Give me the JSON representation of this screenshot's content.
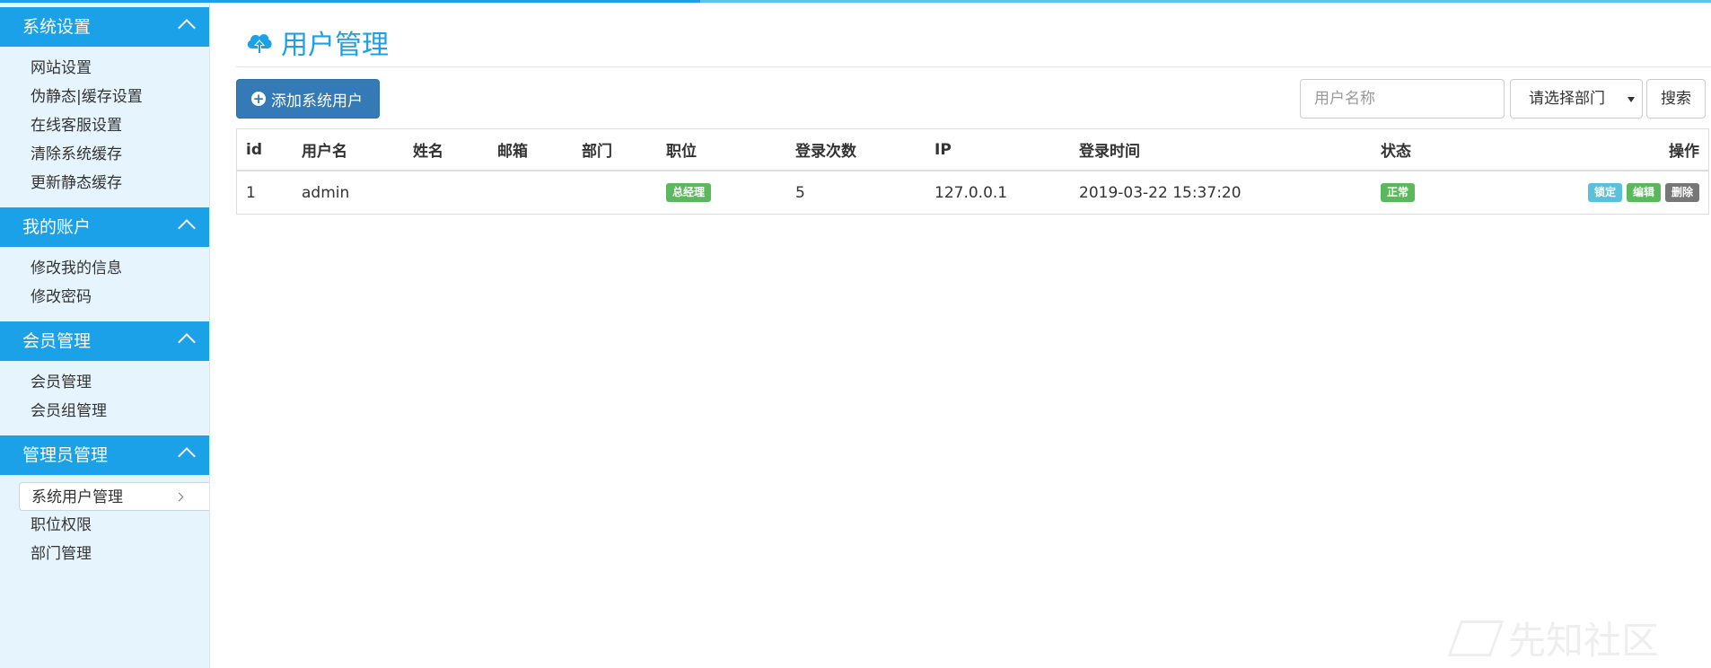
{
  "colors": {
    "primary": "#1aa1e8",
    "sidebar_bg": "#e6f4fe",
    "button_primary": "#337ab7",
    "label_green": "#5cb85c",
    "label_info": "#5bc0de",
    "label_gray": "#777777"
  },
  "sidebar": {
    "groups": [
      {
        "title": "系统设置",
        "items": [
          {
            "label": "网站设置"
          },
          {
            "label": "伪静态|缓存设置"
          },
          {
            "label": "在线客服设置"
          },
          {
            "label": "清除系统缓存"
          },
          {
            "label": "更新静态缓存"
          }
        ]
      },
      {
        "title": "我的账户",
        "items": [
          {
            "label": "修改我的信息"
          },
          {
            "label": "修改密码"
          }
        ]
      },
      {
        "title": "会员管理",
        "items": [
          {
            "label": "会员管理"
          },
          {
            "label": "会员组管理"
          }
        ]
      },
      {
        "title": "管理员管理",
        "items": [
          {
            "label": "系统用户管理",
            "active": true
          },
          {
            "label": "职位权限"
          },
          {
            "label": "部门管理"
          }
        ]
      }
    ]
  },
  "main": {
    "title": "用户管理",
    "title_icon": "cloud-upload-icon",
    "add_button": "添加系统用户",
    "search": {
      "placeholder": "用户名称",
      "value": ""
    },
    "department_select": "请选择部门",
    "search_button": "搜索"
  },
  "table": {
    "columns": [
      "id",
      "用户名",
      "姓名",
      "邮箱",
      "部门",
      "职位",
      "登录次数",
      "IP",
      "登录时间",
      "状态",
      "操作"
    ],
    "rows": [
      {
        "id": "1",
        "username": "admin",
        "name": "",
        "email": "",
        "department": "",
        "position": "总经理",
        "login_count": "5",
        "ip": "127.0.0.1",
        "login_time": "2019-03-22 15:37:20",
        "status": "正常",
        "actions": [
          "锁定",
          "编辑",
          "删除"
        ]
      }
    ]
  },
  "watermark": "先知社区"
}
